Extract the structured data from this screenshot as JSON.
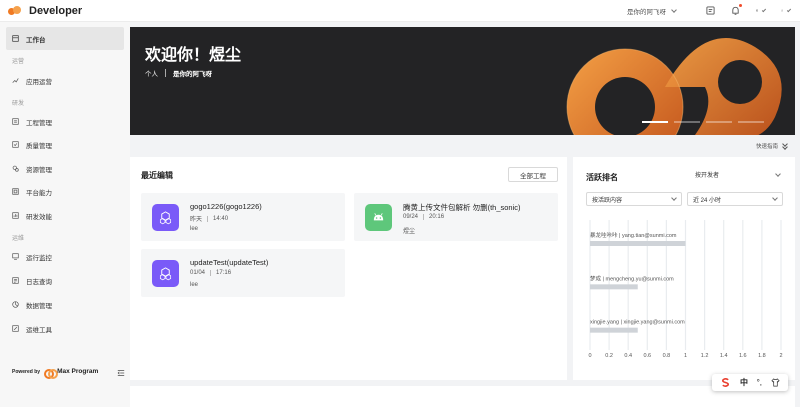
{
  "header": {
    "title": "Developer",
    "team": "是你的阿飞呀"
  },
  "sidebar": {
    "items": [
      {
        "label": "工作台",
        "icon": "home-icon",
        "active": true
      },
      {
        "label": "应用运营",
        "icon": "trend-chart-icon"
      },
      {
        "label": "工程管理",
        "icon": "project-icon"
      },
      {
        "label": "质量管理",
        "icon": "quality-icon"
      },
      {
        "label": "资源管理",
        "icon": "resource-icon"
      },
      {
        "label": "平台能力",
        "icon": "platform-icon"
      },
      {
        "label": "研发效能",
        "icon": "efficiency-icon"
      },
      {
        "label": "运行监控",
        "icon": "monitor-icon"
      },
      {
        "label": "日志查询",
        "icon": "log-icon"
      },
      {
        "label": "数据管理",
        "icon": "data-icon"
      },
      {
        "label": "运维工具",
        "icon": "tools-icon"
      }
    ],
    "groups": [
      "运营",
      "研发",
      "运维"
    ],
    "powered_by": "Powered by",
    "brand": "Max Program"
  },
  "banner": {
    "greeting": "欢迎你！煜尘",
    "personal": "个人",
    "team": "是你的阿飞呀",
    "pages": 4,
    "active_page": 1
  },
  "quick_guide": "快速指南",
  "recent": {
    "title": "最近编辑",
    "all_button": "全部工程",
    "projects": [
      {
        "name": "gogo1226(gogo1226)",
        "date": "昨天",
        "time": "14:40",
        "owner": "lee",
        "icon": "cube-app-icon",
        "color": "#7a5af8"
      },
      {
        "name": "腾黄上传文件包解析 勿删(th_sonic)",
        "date": "09/24",
        "time": "20:16",
        "owner": "煜尘",
        "icon": "android-icon",
        "color": "#5ec77b"
      },
      {
        "name": "updateTest(updateTest)",
        "date": "01/04",
        "time": "17:16",
        "owner": "lee",
        "icon": "cube-app-icon",
        "color": "#7a5af8"
      }
    ]
  },
  "ranking": {
    "title": "活跃排名",
    "by_developer": "按开发者",
    "content_select": "按活跃内容",
    "period_select": "近 24 小时"
  },
  "chart_data": {
    "type": "bar",
    "orientation": "horizontal",
    "categories": [
      "暴龙哇咔咔 | yang.tian@sunmi.com",
      "梦成 | mengcheng.yu@sunmi.com",
      "xingjie.yang | xingjie.yang@sunmi.com"
    ],
    "values": [
      1.0,
      0.5,
      0.5
    ],
    "xlim": [
      0,
      2
    ],
    "xticks": [
      "0",
      "0.2",
      "0.4",
      "0.6",
      "0.8",
      "1",
      "1.2",
      "1.4",
      "1.6",
      "1.8",
      "2"
    ],
    "grid": true,
    "bar_color": "#cfd3d8"
  },
  "ime": {
    "lang": "中",
    "punct": "°,"
  }
}
